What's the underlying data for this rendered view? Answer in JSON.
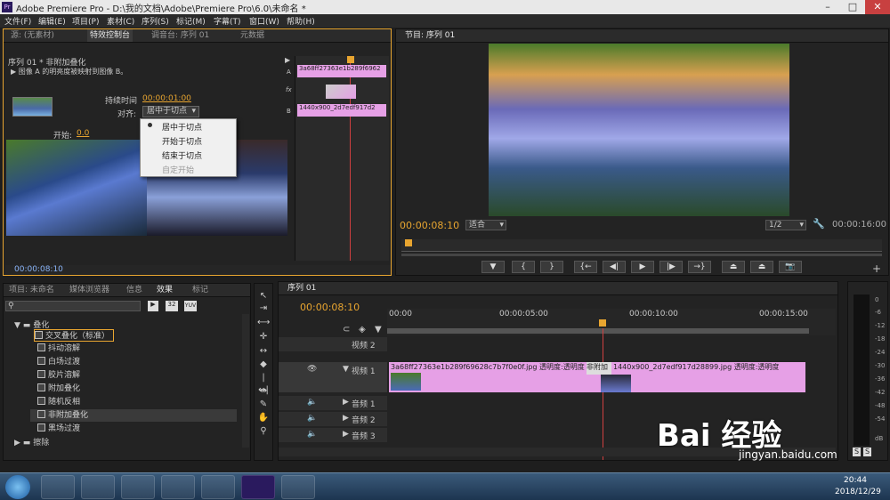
{
  "window": {
    "title": "Adobe Premiere Pro - D:\\我的文档\\Adobe\\Premiere Pro\\6.0\\未命名 *",
    "logo": "Pr"
  },
  "menu": [
    "文件(F)",
    "编辑(E)",
    "项目(P)",
    "素材(C)",
    "序列(S)",
    "标记(M)",
    "字幕(T)",
    "窗口(W)",
    "帮助(H)"
  ],
  "source_panel": {
    "tabs": [
      "源: (无素材)",
      "特效控制台",
      "调音台: 序列 01",
      "元数据"
    ],
    "header": "序列 01 * 非附加叠化",
    "description": "图像 A 的明亮度被映射到图像 B。",
    "duration_label": "持续时间",
    "duration_value": "00:00:01:00",
    "align_label": "对齐:",
    "align_value": "居中于切点",
    "start_label": "开始:",
    "start_value": "0.0",
    "dropdown_options": [
      "居中于切点",
      "开始于切点",
      "结束于切点",
      "自定开始"
    ],
    "clip_a_name": "3a68ff27363e1b289f6962",
    "clip_b_name": "1440x900_2d7edf917d2",
    "timecode": "00:00:08:10",
    "track_a": "A",
    "track_b": "B",
    "fx": "fx"
  },
  "program_panel": {
    "tab": "节目: 序列 01",
    "timecode": "00:00:08:10",
    "fit": "适合",
    "scale": "1/2",
    "duration": "00:00:16:00"
  },
  "project_panel": {
    "tabs": [
      "项目: 未命名",
      "媒体浏览器",
      "信息",
      "效果",
      "标记"
    ],
    "folder": "叠化",
    "items": [
      "交叉叠化（标准）",
      "抖动溶解",
      "白场过渡",
      "胶片溶解",
      "附加叠化",
      "随机反相",
      "非附加叠化",
      "黑场过渡"
    ],
    "folder2": "擦除",
    "badges": [
      "32",
      "YUV"
    ]
  },
  "timeline": {
    "tab": "序列 01",
    "timecode": "00:00:08:10",
    "ruler": [
      "00:00",
      "00:00:05:00",
      "00:00:10:00",
      "00:00:15:00"
    ],
    "tracks": [
      "视频 2",
      "视频 1",
      "音频 1",
      "音频 2",
      "音频 3"
    ],
    "clip1": "3a68ff27363e1b289f69628c7b7f0e0f.jpg 透明度:透明度",
    "transition": "非附加",
    "clip2": "1440x900_2d7edf917d28899.jpg 透明度:透明度"
  },
  "meter": {
    "ticks": [
      "0",
      "-6",
      "-12",
      "-18",
      "-24",
      "-30",
      "-36",
      "-42",
      "-48",
      "-54",
      "dB"
    ],
    "solo": [
      "S",
      "S"
    ]
  },
  "taskbar": {
    "time": "20:44",
    "date": "2018/12/29"
  },
  "watermark": {
    "brand": "Bai 经验",
    "url": "jingyan.baidu.com"
  }
}
